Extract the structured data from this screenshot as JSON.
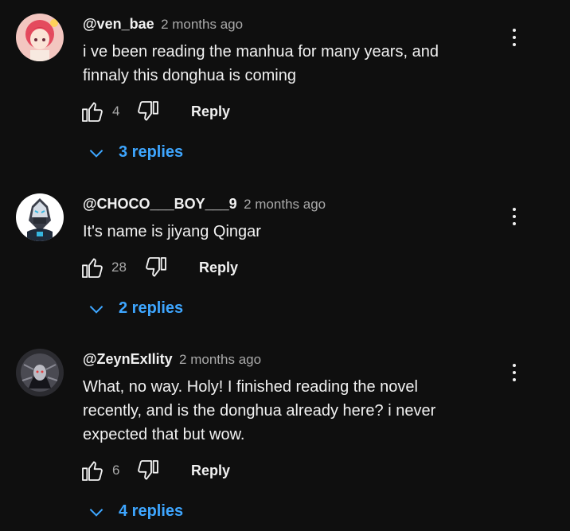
{
  "comments": [
    {
      "author": "@ven_bae",
      "time": "2 months ago",
      "lines": [
        "i ve been reading the manhua for many years, and",
        "finnaly this donghua is coming"
      ],
      "likes": "4",
      "reply_label": "Reply",
      "replies_label": "3 replies",
      "avatar_icon": "anime-girl-avatar"
    },
    {
      "author": "@CHOCO___BOY___9",
      "time": "2 months ago",
      "lines": [
        "It's name is jiyang Qingar"
      ],
      "likes": "28",
      "reply_label": "Reply",
      "replies_label": "2 replies",
      "avatar_icon": "masked-character-avatar"
    },
    {
      "author": "@ZeynExIlity",
      "time": "2 months ago",
      "lines": [
        "What, no way. Holy! I finished reading the novel",
        "recently, and is the donghua already here?  i never",
        "expected that but wow."
      ],
      "likes": "6",
      "reply_label": "Reply",
      "replies_label": "4 replies",
      "avatar_icon": "dark-hooded-avatar"
    }
  ],
  "colors": {
    "background": "#0f0f0f",
    "text": "#f1f1f1",
    "secondary": "#aaaaaa",
    "link": "#3ea6ff"
  }
}
